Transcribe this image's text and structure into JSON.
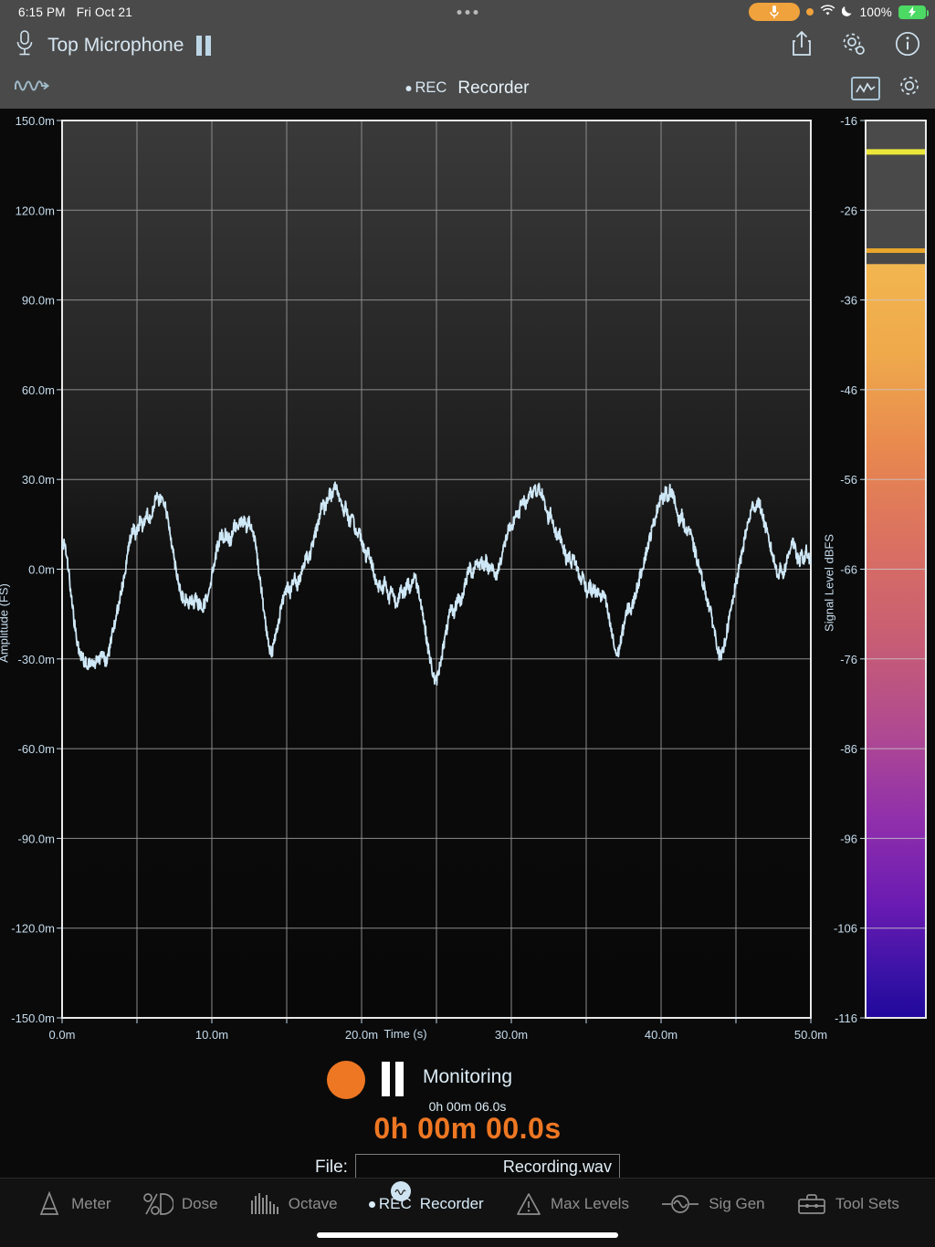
{
  "status_bar": {
    "time": "6:15 PM",
    "date": "Fri Oct 21",
    "battery_percent": "100%",
    "icons": [
      "mic-active-pill",
      "orange-privacy-dot",
      "wifi-icon",
      "moon-icon",
      "battery-charging-icon"
    ]
  },
  "title_bar": {
    "mic_icon": "microphone-icon",
    "title": "Top Microphone",
    "pause_icon": "pause-icon",
    "share_icon": "share-icon",
    "settings_icon": "gear-settings-icon",
    "info_icon": "info-icon"
  },
  "sub_bar": {
    "signal_icon": "waveform-flow-icon",
    "rec_label": "REC",
    "screen_title": "Recorder",
    "chart_icon": "chart-view-icon",
    "gear_icon": "gear-icon"
  },
  "chart_data": {
    "type": "line",
    "title": "",
    "xlabel": "Time (s)",
    "ylabel": "Amplitude (FS)",
    "xlim": [
      0,
      0.05
    ],
    "ylim": [
      -0.15,
      0.15
    ],
    "x_ticks": [
      "0.0m",
      "10.0m",
      "20.0m",
      "30.0m",
      "40.0m",
      "50.0m"
    ],
    "x_tick_values": [
      0,
      0.01,
      0.02,
      0.03,
      0.04,
      0.05
    ],
    "x_minor_step": 0.005,
    "y_ticks": [
      "150.0m",
      "120.0m",
      "90.0m",
      "60.0m",
      "30.0m",
      "0.0m",
      "-30.0m",
      "-60.0m",
      "-90.0m",
      "-120.0m",
      "-150.0m"
    ],
    "y_tick_values": [
      0.15,
      0.12,
      0.09,
      0.06,
      0.03,
      0.0,
      -0.03,
      -0.06,
      -0.09,
      -0.12,
      -0.15
    ],
    "grid": true,
    "legend": "none",
    "trace_color": "#cfe8f7",
    "series": [
      {
        "name": "Top Microphone waveform",
        "y": [
          0.006,
          0.01,
          0.005,
          -0.002,
          -0.009,
          -0.016,
          -0.021,
          -0.026,
          -0.029,
          -0.03,
          -0.031,
          -0.033,
          -0.031,
          -0.03,
          -0.032,
          -0.03,
          -0.031,
          -0.029,
          -0.029,
          -0.031,
          -0.029,
          -0.025,
          -0.021,
          -0.018,
          -0.014,
          -0.01,
          -0.006,
          -0.002,
          0.003,
          0.008,
          0.011,
          0.014,
          0.011,
          0.014,
          0.017,
          0.014,
          0.017,
          0.019,
          0.017,
          0.019,
          0.022,
          0.025,
          0.022,
          0.024,
          0.023,
          0.02,
          0.016,
          0.012,
          0.007,
          0.002,
          -0.002,
          -0.006,
          -0.009,
          -0.011,
          -0.01,
          -0.012,
          -0.01,
          -0.012,
          -0.01,
          -0.012,
          -0.011,
          -0.013,
          -0.011,
          -0.009,
          -0.006,
          -0.002,
          0.002,
          0.006,
          0.009,
          0.012,
          0.01,
          0.012,
          0.011,
          0.009,
          0.012,
          0.015,
          0.013,
          0.017,
          0.015,
          0.016,
          0.014,
          0.016,
          0.014,
          0.012,
          0.008,
          0.002,
          -0.004,
          -0.01,
          -0.016,
          -0.022,
          -0.026,
          -0.028,
          -0.025,
          -0.021,
          -0.017,
          -0.013,
          -0.01,
          -0.007,
          -0.005,
          -0.008,
          -0.005,
          -0.003,
          -0.006,
          -0.003,
          -0.001,
          0.002,
          0.005,
          0.003,
          0.006,
          0.009,
          0.012,
          0.015,
          0.019,
          0.022,
          0.02,
          0.023,
          0.026,
          0.024,
          0.027,
          0.028,
          0.025,
          0.023,
          0.019,
          0.021,
          0.018,
          0.015,
          0.017,
          0.014,
          0.011,
          0.013,
          0.01,
          0.007,
          0.004,
          0.006,
          0.003,
          0.0,
          -0.003,
          -0.006,
          -0.005,
          -0.007,
          -0.004,
          -0.007,
          -0.01,
          -0.006,
          -0.009,
          -0.012,
          -0.009,
          -0.007,
          -0.009,
          -0.007,
          -0.004,
          -0.007,
          -0.004,
          -0.002,
          -0.005,
          -0.008,
          -0.012,
          -0.017,
          -0.022,
          -0.027,
          -0.031,
          -0.035,
          -0.038,
          -0.036,
          -0.032,
          -0.028,
          -0.024,
          -0.02,
          -0.016,
          -0.013,
          -0.015,
          -0.012,
          -0.009,
          -0.011,
          -0.008,
          -0.005,
          -0.002,
          0.001,
          -0.002,
          0.001,
          0.003,
          0.001,
          0.003,
          0.001,
          0.003,
          0.0,
          0.002,
          0.0,
          -0.003,
          -0.001,
          0.002,
          0.005,
          0.008,
          0.011,
          0.014,
          0.012,
          0.016,
          0.019,
          0.017,
          0.021,
          0.024,
          0.021,
          0.023,
          0.026,
          0.024,
          0.027,
          0.025,
          0.027,
          0.026,
          0.023,
          0.02,
          0.017,
          0.019,
          0.016,
          0.013,
          0.01,
          0.012,
          0.009,
          0.006,
          0.003,
          0.005,
          0.002,
          0.004,
          0.002,
          -0.001,
          -0.004,
          -0.002,
          -0.005,
          -0.008,
          -0.005,
          -0.008,
          -0.006,
          -0.009,
          -0.007,
          -0.01,
          -0.008,
          -0.011,
          -0.015,
          -0.019,
          -0.023,
          -0.027,
          -0.029,
          -0.026,
          -0.022,
          -0.018,
          -0.015,
          -0.012,
          -0.014,
          -0.011,
          -0.008,
          -0.005,
          -0.002,
          0.001,
          0.004,
          0.007,
          0.01,
          0.013,
          0.016,
          0.019,
          0.022,
          0.025,
          0.023,
          0.026,
          0.024,
          0.027,
          0.025,
          0.022,
          0.019,
          0.016,
          0.018,
          0.015,
          0.012,
          0.014,
          0.011,
          0.008,
          0.005,
          0.002,
          -0.001,
          -0.004,
          -0.007,
          -0.01,
          -0.013,
          -0.016,
          -0.02,
          -0.024,
          -0.028,
          -0.03,
          -0.027,
          -0.023,
          -0.019,
          -0.015,
          -0.011,
          -0.007,
          -0.003,
          0.001,
          0.005,
          0.009,
          0.013,
          0.016,
          0.019,
          0.022,
          0.02,
          0.023,
          0.021,
          0.018,
          0.015,
          0.012,
          0.009,
          0.006,
          0.003,
          0.0,
          -0.002,
          0.001,
          -0.002,
          0.001,
          0.004,
          0.007,
          0.01,
          0.007,
          0.004,
          0.002,
          0.005,
          0.003,
          0.006,
          0.004,
          0.002
        ]
      }
    ]
  },
  "level_meter": {
    "axis_label": "Signal Level dBFS",
    "scale_max": -16,
    "scale_min": -116,
    "ticks": [
      -16,
      -26,
      -36,
      -46,
      -56,
      -66,
      -76,
      -86,
      -96,
      -106,
      -116
    ],
    "current_level": -32,
    "peak_hold": -19.5,
    "peak_marker": -30.5,
    "peak_hold_color": "#ebe73a",
    "peak_marker_color": "#e8a62b",
    "gradient_top_color": "#f0b04a",
    "gradient_bottom_color": "#21089c"
  },
  "transport": {
    "record_button": "record-button",
    "pause_button": "pause-button",
    "status": "Monitoring",
    "elapsed_small": "0h 00m 06.0s",
    "elapsed_big": "0h 00m 00.0s",
    "elapsed_color": "#ee7723",
    "file_label": "File:",
    "file_name": "Recording.wav",
    "file_placeholder": "Recording.wav"
  },
  "tab_bar": {
    "items": [
      {
        "label": "Meter",
        "icon": "meter-cone-icon",
        "active": false
      },
      {
        "label": "Dose",
        "icon": "dose-percent-icon",
        "active": false
      },
      {
        "label": "Octave",
        "icon": "octave-bars-icon",
        "active": false
      },
      {
        "label": "Recorder",
        "icon": "rec-icon",
        "active": true
      },
      {
        "label": "Max Levels",
        "icon": "warning-icon",
        "active": false
      },
      {
        "label": "Sig Gen",
        "icon": "sine-gen-icon",
        "active": false
      },
      {
        "label": "Tool Sets",
        "icon": "toolbox-icon",
        "active": false
      }
    ]
  }
}
